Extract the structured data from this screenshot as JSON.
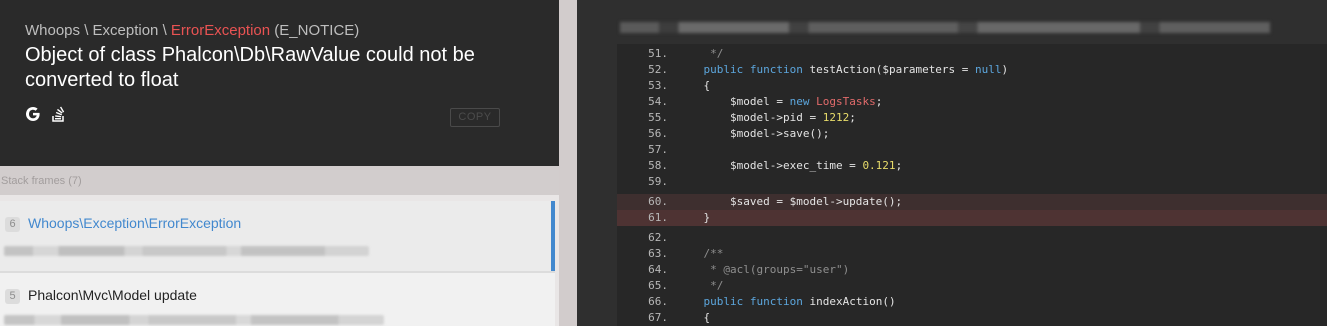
{
  "exception": {
    "namespace": "Whoops \\ Exception \\ ",
    "class": "ErrorException",
    "code": " (E_NOTICE)",
    "message": "Object of class Phalcon\\Db\\RawValue could not be converted to float",
    "copy_label": "COPY"
  },
  "icons": {
    "google": "google-search-icon",
    "stackoverflow": "stackoverflow-icon"
  },
  "stack": {
    "label": "Stack frames (7)",
    "frames": [
      {
        "index": "6",
        "class": "Whoops\\Exception\\ErrorException"
      },
      {
        "index": "5",
        "class": "Phalcon\\Mvc\\Model update"
      }
    ]
  },
  "code": {
    "lines": [
      {
        "num": "51.",
        "text": "     */"
      },
      {
        "num": "52.",
        "text": "    public function testAction($parameters = null)"
      },
      {
        "num": "53.",
        "text": "    {"
      },
      {
        "num": "54.",
        "text": "        $model = new LogsTasks;"
      },
      {
        "num": "55.",
        "text": "        $model->pid = 1212;"
      },
      {
        "num": "56.",
        "text": "        $model->save();"
      },
      {
        "num": "57.",
        "text": ""
      },
      {
        "num": "58.",
        "text": "        $model->exec_time = 0.121;"
      },
      {
        "num": "59.",
        "text": ""
      },
      {
        "num": "60.",
        "text": "        $saved = $model->update();"
      },
      {
        "num": "61.",
        "text": "    }"
      },
      {
        "num": "62.",
        "text": ""
      },
      {
        "num": "63.",
        "text": "    /**"
      },
      {
        "num": "64.",
        "text": "     * @acl(groups=\"user\")"
      },
      {
        "num": "65.",
        "text": "     */"
      },
      {
        "num": "66.",
        "text": "    public function indexAction()"
      },
      {
        "num": "67.",
        "text": "    {"
      }
    ],
    "highlighted_lines": [
      "60.",
      "61."
    ]
  },
  "colors": {
    "accent": "#4288ce",
    "error": "#e95353",
    "header_bg": "#2a2a2a",
    "code_bg": "#272727"
  }
}
